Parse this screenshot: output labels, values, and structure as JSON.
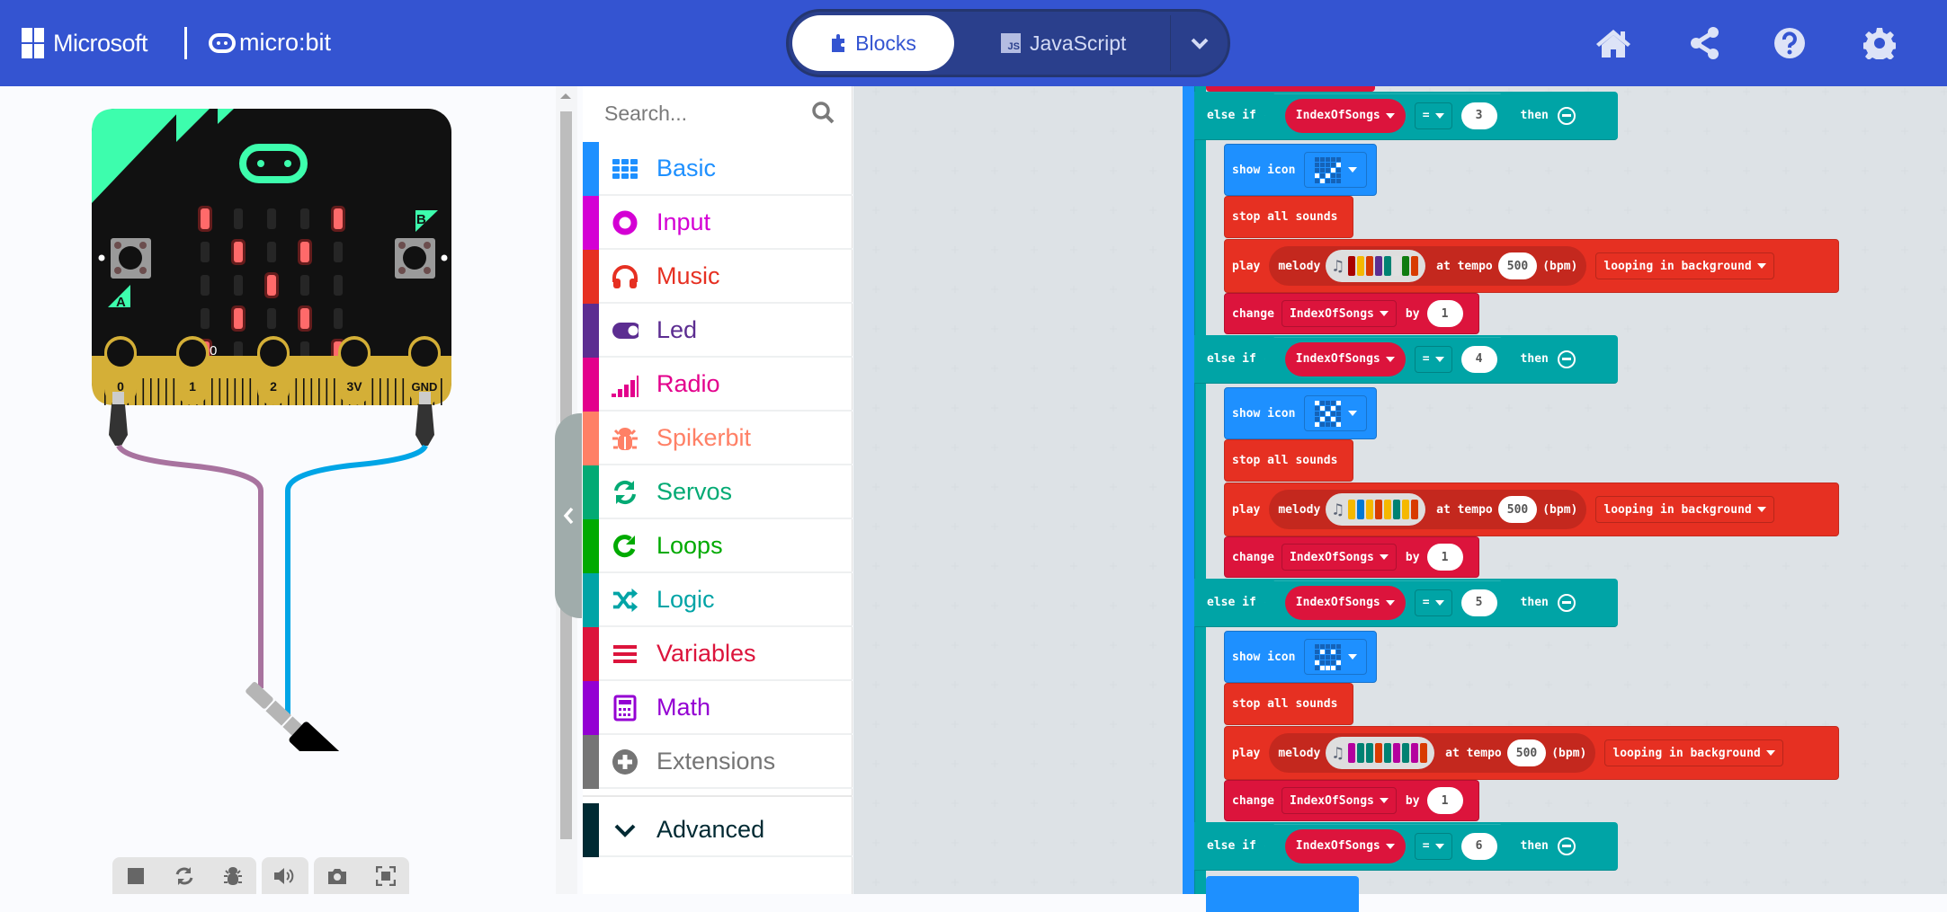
{
  "header": {
    "brand": "Microsoft",
    "product": "micro:bit",
    "tabs": {
      "blocks": "Blocks",
      "javascript": "JavaScript",
      "js_badge": "JS"
    },
    "icons": [
      "home-icon",
      "share-icon",
      "help-icon",
      "settings-icon"
    ]
  },
  "simulator": {
    "pin_labels": [
      "0",
      "1",
      "2",
      "3V",
      "GND"
    ],
    "button_labels": {
      "a": "A",
      "b": "B"
    },
    "pin_value_readout": "0",
    "led_matrix": [
      [
        1,
        0,
        0,
        0,
        1
      ],
      [
        0,
        1,
        0,
        1,
        0
      ],
      [
        0,
        0,
        1,
        0,
        0
      ],
      [
        0,
        1,
        0,
        1,
        0
      ],
      [
        1,
        0,
        0,
        0,
        1
      ]
    ],
    "toolbar": [
      "stop",
      "restart",
      "debug",
      "mute",
      "screenshot",
      "fullscreen"
    ]
  },
  "toolbox": {
    "search_placeholder": "Search...",
    "categories": [
      {
        "label": "Basic",
        "color": "#1e90ff",
        "icon": "grid-icon"
      },
      {
        "label": "Input",
        "color": "#d400d4",
        "icon": "input-circle-icon"
      },
      {
        "label": "Music",
        "color": "#e63022",
        "icon": "headphones-icon"
      },
      {
        "label": "Led",
        "color": "#5c2d91",
        "icon": "toggle-icon"
      },
      {
        "label": "Radio",
        "color": "#e3008c",
        "icon": "signal-bars-icon"
      },
      {
        "label": "Spikerbit",
        "color": "#ff8066",
        "icon": "bug-icon"
      },
      {
        "label": "Servos",
        "color": "#03aa74",
        "icon": "refresh-icon"
      },
      {
        "label": "Loops",
        "color": "#00aa00",
        "icon": "loop-icon"
      },
      {
        "label": "Logic",
        "color": "#00a4a6",
        "icon": "shuffle-icon"
      },
      {
        "label": "Variables",
        "color": "#dc143c",
        "icon": "lines-icon"
      },
      {
        "label": "Math",
        "color": "#9400d3",
        "icon": "calculator-icon"
      },
      {
        "label": "Extensions",
        "color": "#757575",
        "icon": "plus-circle-icon"
      }
    ],
    "advanced": {
      "label": "Advanced",
      "color": "#002a33"
    }
  },
  "workspace": {
    "keywords": {
      "else_if": "else if",
      "then": "then",
      "show_icon": "show icon",
      "stop_all_sounds": "stop all sounds",
      "play": "play",
      "melody": "melody",
      "at_tempo": "at tempo",
      "bpm": "(bpm)",
      "change": "change",
      "by": "by",
      "eq": "="
    },
    "variable": "IndexOfSongs",
    "branches": [
      {
        "compare_value": "3",
        "icon": [
          [
            0,
            0,
            0,
            0,
            0
          ],
          [
            0,
            0,
            0,
            0,
            1
          ],
          [
            0,
            0,
            0,
            1,
            0
          ],
          [
            1,
            0,
            1,
            0,
            0
          ],
          [
            0,
            1,
            0,
            0,
            0
          ]
        ],
        "melody_colors": [
          "#a80000",
          "#f5b800",
          "#d83b01",
          "#5c2d91",
          "#008272",
          "#e0e0e0",
          "#107c10",
          "#d83b01"
        ],
        "tempo": "500",
        "mode": "looping in background",
        "change_by": "1"
      },
      {
        "compare_value": "4",
        "icon": [
          [
            1,
            0,
            0,
            0,
            1
          ],
          [
            0,
            1,
            0,
            1,
            0
          ],
          [
            0,
            0,
            1,
            0,
            0
          ],
          [
            0,
            1,
            0,
            1,
            0
          ],
          [
            1,
            0,
            0,
            0,
            1
          ]
        ],
        "melody_colors": [
          "#f5b800",
          "#0078d4",
          "#f5b800",
          "#d83b01",
          "#f5b800",
          "#008272",
          "#f5b800",
          "#d83b01"
        ],
        "tempo": "500",
        "mode": "looping in background",
        "change_by": "1"
      },
      {
        "compare_value": "5",
        "icon": [
          [
            0,
            0,
            0,
            0,
            0
          ],
          [
            0,
            1,
            0,
            1,
            0
          ],
          [
            0,
            0,
            0,
            0,
            0
          ],
          [
            1,
            0,
            0,
            0,
            1
          ],
          [
            0,
            1,
            1,
            1,
            0
          ]
        ],
        "melody_colors": [
          "#b4009e",
          "#008272",
          "#008272",
          "#d83b01",
          "#008272",
          "#b4009e",
          "#008272",
          "#b4009e",
          "#d83b01"
        ],
        "tempo": "500",
        "mode": "looping in background",
        "change_by": "1"
      },
      {
        "compare_value": "6"
      }
    ]
  }
}
